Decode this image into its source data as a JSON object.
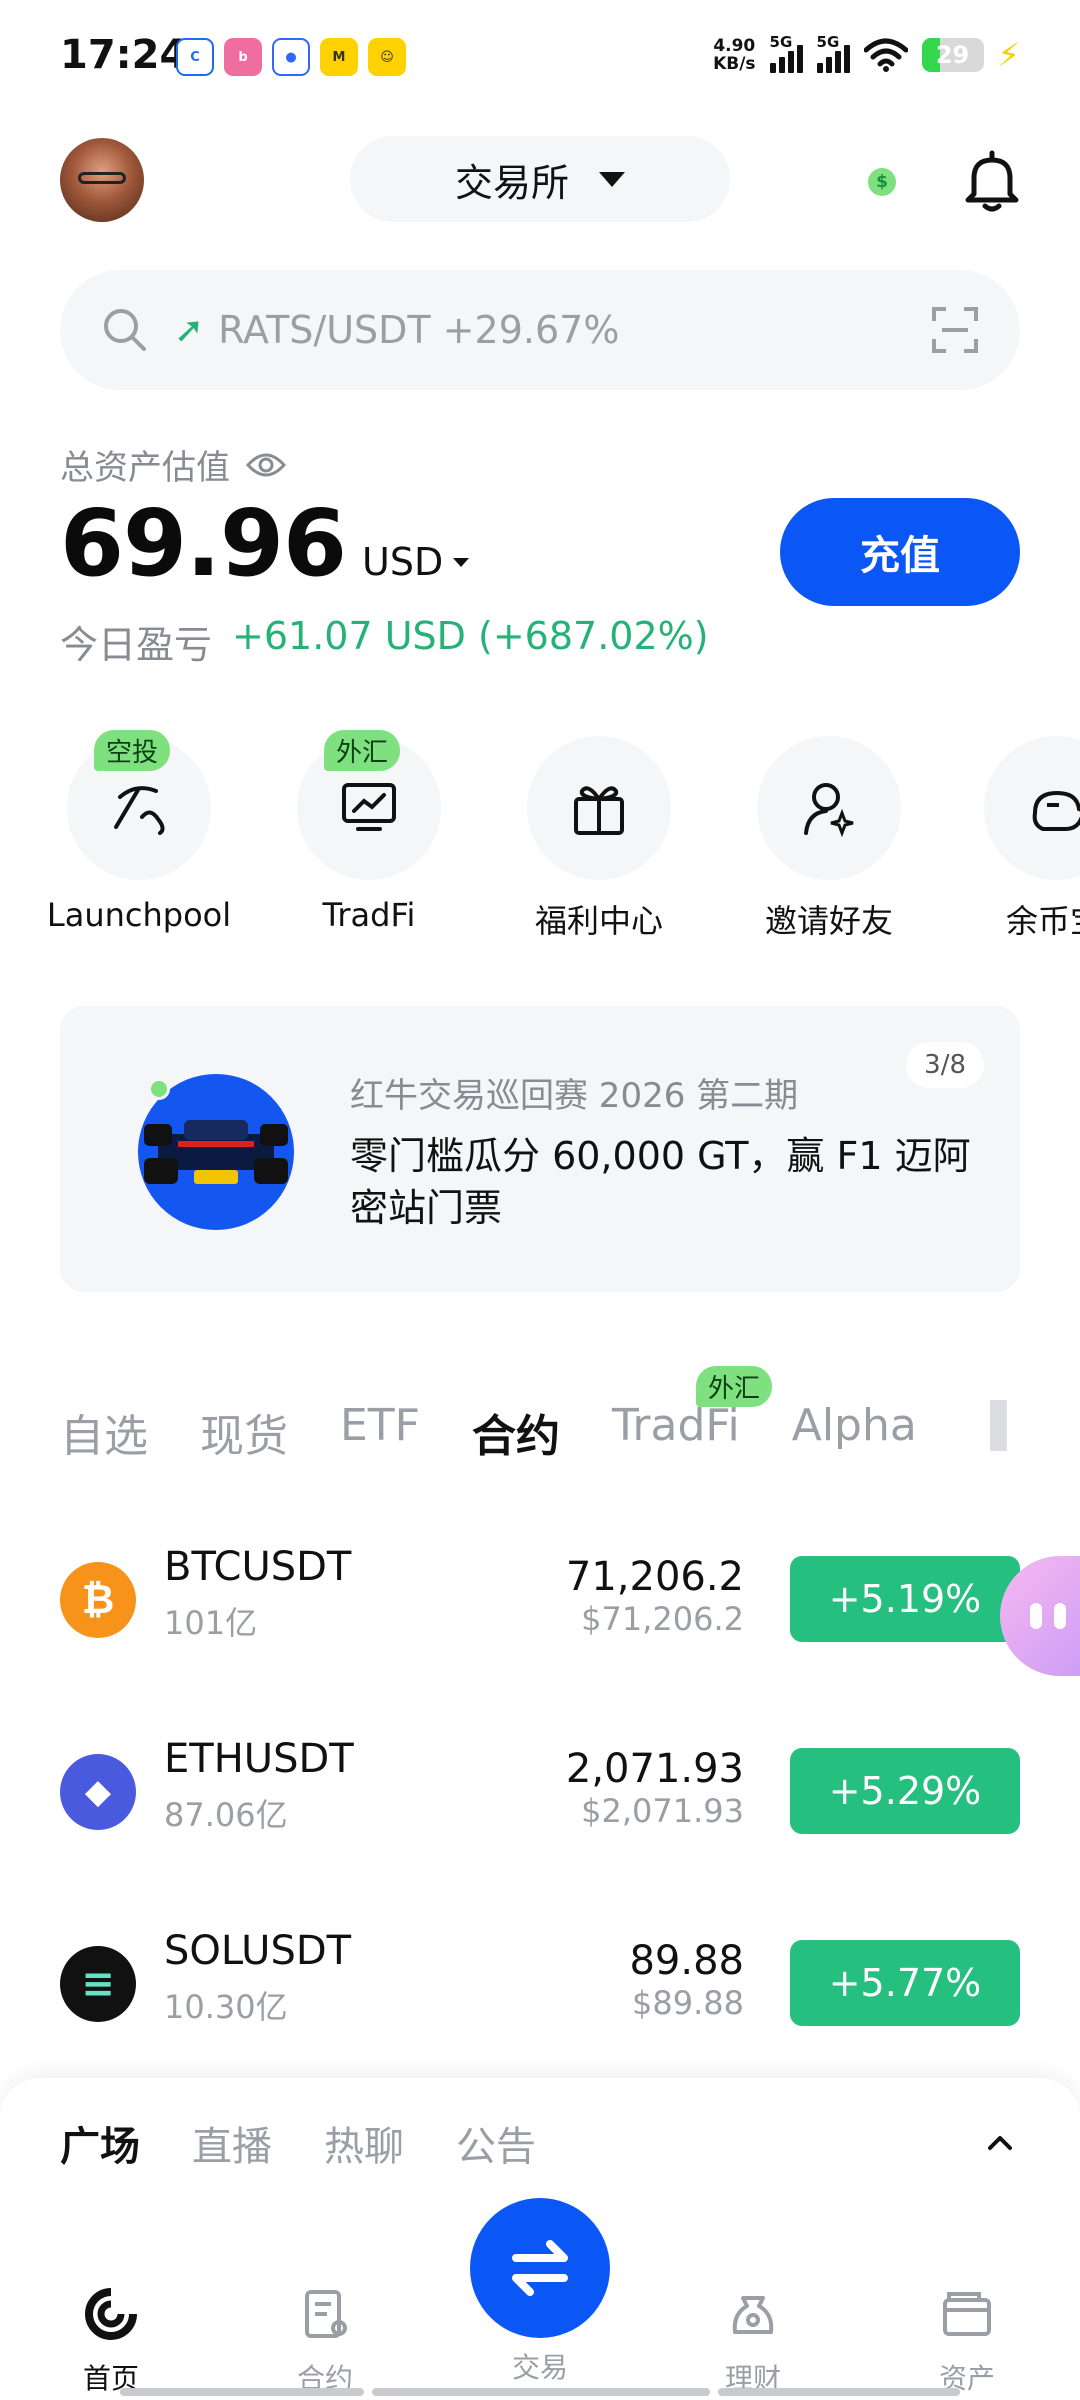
{
  "status_bar": {
    "time": "17:24",
    "net_speed_value": "4.90",
    "net_speed_unit": "KB/s",
    "sim1": "5G",
    "sim2": "5G",
    "battery": "29"
  },
  "header": {
    "exchange_label": "交易所"
  },
  "search": {
    "placeholder": "RATS/USDT +29.67%"
  },
  "assets": {
    "label": "总资产估值",
    "value": "69.96",
    "currency": "USD",
    "deposit_label": "充值",
    "pnl_label": "今日盈亏",
    "pnl_value": "+61.07 USD (+687.02%)"
  },
  "quick_actions": [
    {
      "label": "Launchpool",
      "tag": "空投",
      "icon": "pickaxe-icon"
    },
    {
      "label": "TradFi",
      "tag": "外汇",
      "icon": "chart-monitor-icon"
    },
    {
      "label": "福利中心",
      "tag": "",
      "icon": "gift-icon"
    },
    {
      "label": "邀请好友",
      "tag": "",
      "icon": "invite-user-icon"
    },
    {
      "label": "余币宝",
      "tag": "",
      "icon": "piggy-bank-icon"
    }
  ],
  "banner": {
    "subtitle": "红牛交易巡回赛 2026 第二期",
    "title": "零门槛瓜分 60,000 GT，赢 F1 迈阿密站门票",
    "page": "3/8"
  },
  "market_tabs": [
    {
      "label": "自选",
      "active": false,
      "tag": ""
    },
    {
      "label": "现货",
      "active": false,
      "tag": ""
    },
    {
      "label": "ETF",
      "active": false,
      "tag": ""
    },
    {
      "label": "合约",
      "active": true,
      "tag": ""
    },
    {
      "label": "TradFi",
      "active": false,
      "tag": "外汇"
    },
    {
      "label": "Alpha",
      "active": false,
      "tag": ""
    }
  ],
  "market_rows": [
    {
      "symbol": "BTCUSDT",
      "volume": "101亿",
      "price": "71,206.2",
      "fiat": "$71,206.2",
      "change": "+5.19%",
      "coin_color": "#f7931a",
      "coin_glyph": "₿"
    },
    {
      "symbol": "ETHUSDT",
      "volume": "87.06亿",
      "price": "2,071.93",
      "fiat": "$2,071.93",
      "change": "+5.29%",
      "coin_color": "#4a5adf",
      "coin_glyph": "◆"
    },
    {
      "symbol": "SOLUSDT",
      "volume": "10.30亿",
      "price": "89.88",
      "fiat": "$89.88",
      "change": "+5.77%",
      "coin_color": "#111111",
      "coin_glyph": "≡"
    }
  ],
  "sheet": {
    "tabs": [
      {
        "label": "广场",
        "active": true
      },
      {
        "label": "直播",
        "active": false
      },
      {
        "label": "热聊",
        "active": false
      },
      {
        "label": "公告",
        "active": false
      }
    ]
  },
  "bottom_nav": {
    "home": "首页",
    "futures": "合约",
    "trade": "交易",
    "earn": "理财",
    "assets": "资产"
  },
  "colors": {
    "accent": "#0a57f5",
    "up": "#25c07f",
    "tag": "#7ee07e"
  }
}
